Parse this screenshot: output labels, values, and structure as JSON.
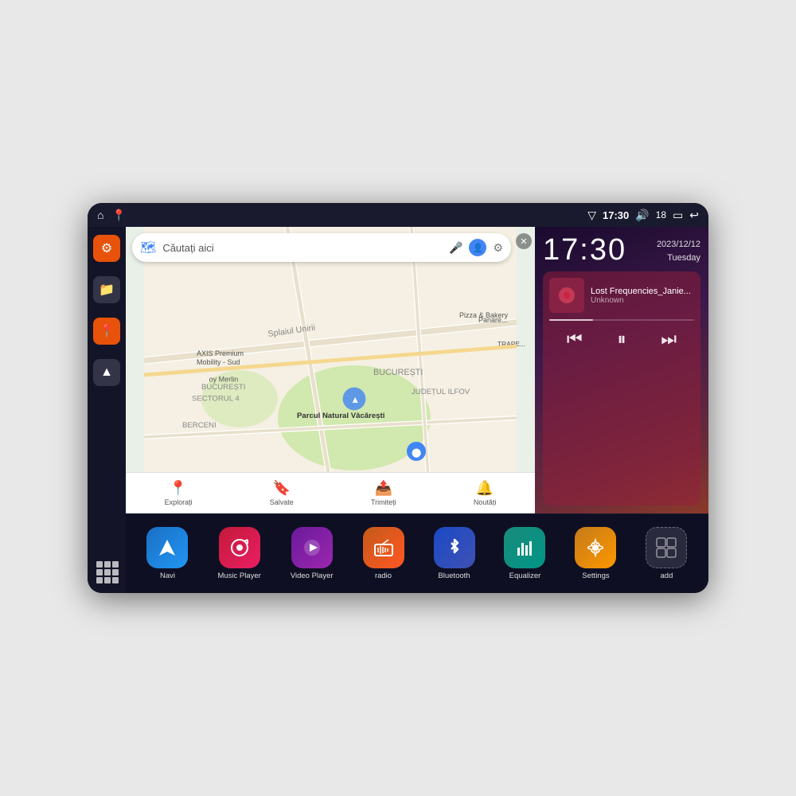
{
  "device": {
    "statusBar": {
      "leftIcons": [
        "⌂",
        "📍"
      ],
      "wifi": "▼",
      "time": "17:30",
      "volume": "🔊",
      "batteryNum": "18",
      "battery": "🔋",
      "back": "↩"
    },
    "clock": {
      "time": "17:30",
      "date": "2023/12/12",
      "day": "Tuesday"
    },
    "music": {
      "title": "Lost Frequencies_Janie...",
      "artist": "Unknown",
      "albumArt": "🎵"
    },
    "map": {
      "searchPlaceholder": "Căutați aici",
      "bottomItems": [
        {
          "icon": "📍",
          "label": "Explorați"
        },
        {
          "icon": "🔖",
          "label": "Salvate"
        },
        {
          "icon": "📤",
          "label": "Trimiteți"
        },
        {
          "icon": "🔔",
          "label": "Noutăți"
        }
      ]
    },
    "apps": [
      {
        "label": "Navi",
        "icon": "▲",
        "colorClass": "blue"
      },
      {
        "label": "Music Player",
        "icon": "🎵",
        "colorClass": "red"
      },
      {
        "label": "Video Player",
        "icon": "▶",
        "colorClass": "purple"
      },
      {
        "label": "radio",
        "icon": "📻",
        "colorClass": "orange"
      },
      {
        "label": "Bluetooth",
        "icon": "⚡",
        "colorClass": "blue2"
      },
      {
        "label": "Equalizer",
        "icon": "📊",
        "colorClass": "teal"
      },
      {
        "label": "Settings",
        "icon": "⚙",
        "colorClass": "orange2"
      },
      {
        "label": "add",
        "icon": "+",
        "colorClass": "gray"
      }
    ]
  }
}
